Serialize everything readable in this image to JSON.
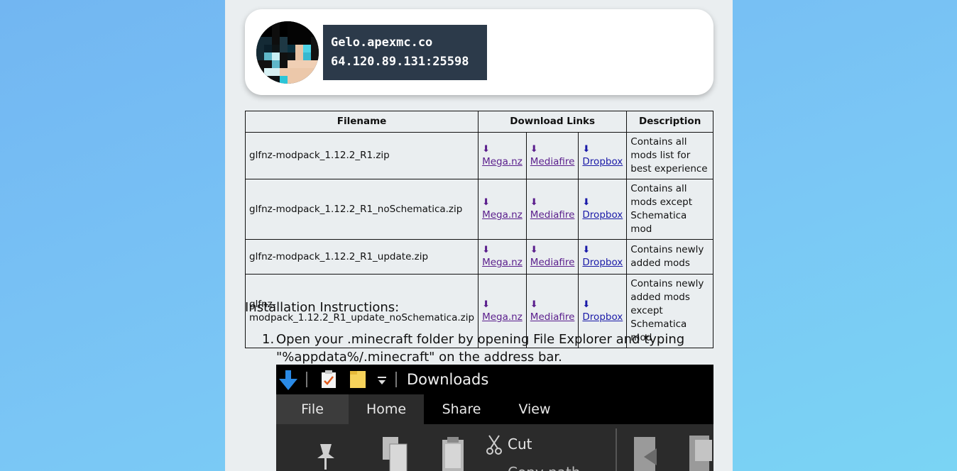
{
  "server": {
    "hostname": "Gelo.apexmc.co",
    "address": "64.120.89.131:25598"
  },
  "table": {
    "headers": [
      "Filename",
      "Download Links",
      "Description"
    ],
    "arrow_icon": "⬇",
    "rows": [
      {
        "filename": "glfnz-modpack_1.12.2_R1.zip",
        "mega": "Mega.nz",
        "mediafire": "Mediafire",
        "dropbox": "Dropbox",
        "description": "Contains all mods list for best experience"
      },
      {
        "filename": "glfnz-modpack_1.12.2_R1_noSchematica.zip",
        "mega": "Mega.nz",
        "mediafire": "Mediafire",
        "dropbox": "Dropbox",
        "description": "Contains all mods except Schematica mod"
      },
      {
        "filename": "glfnz-modpack_1.12.2_R1_update.zip",
        "mega": "Mega.nz",
        "mediafire": "Mediafire",
        "dropbox": "Dropbox",
        "description": "Contains newly added mods"
      },
      {
        "filename": "glfnz-modpack_1.12.2_R1_update_noSchematica.zip",
        "mega": "Mega.nz",
        "mediafire": "Mediafire",
        "dropbox": "Dropbox",
        "description": "Contains newly added mods except Schematica mod"
      }
    ]
  },
  "instructions": {
    "title": "Installation Instructions:",
    "steps": [
      {
        "number": "1.",
        "text": "Open your .minecraft folder by opening File Explorer and typing \"%appdata%/.minecraft\" on the address bar."
      }
    ]
  },
  "explorer": {
    "window_title": "Downloads",
    "tabs": [
      "File",
      "Home",
      "Share",
      "View"
    ],
    "active_tab": "Home",
    "ribbon_items": [
      "Cut",
      "Copy path"
    ]
  },
  "colors": {
    "background": "#76c0f4",
    "page": "#eaeef0",
    "server_box": "#2c3a4a",
    "visited_link": "#5a1e8c",
    "link": "#1a1aa8"
  }
}
